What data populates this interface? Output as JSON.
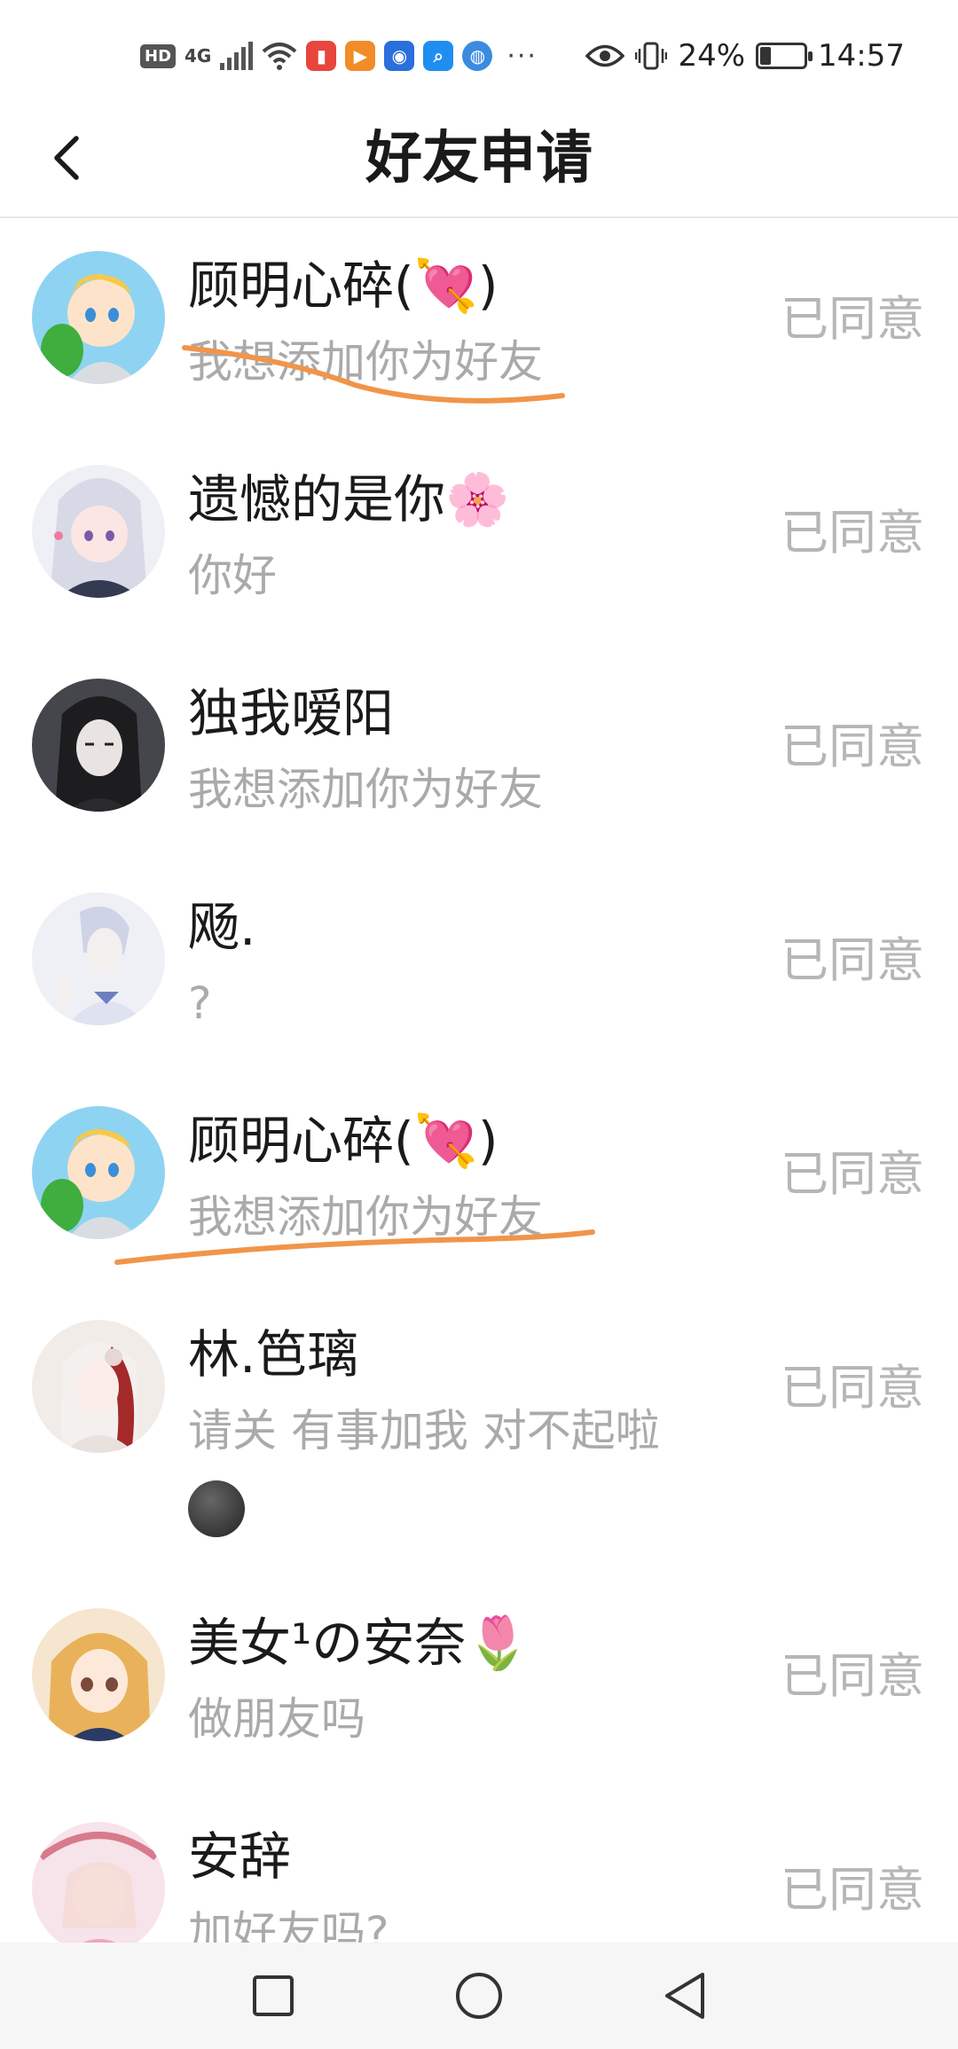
{
  "status_bar": {
    "hd": "HD",
    "network": "4G",
    "more": "···",
    "battery": "24%",
    "time": "14:57",
    "battery_level": 0.24
  },
  "header": {
    "title": "好友申请"
  },
  "requests": [
    {
      "name": "顾明心碎(💘)",
      "message": "我想添加你为好友",
      "status": "已同意"
    },
    {
      "name": "遗憾的是你🌸",
      "message": "你好",
      "status": "已同意"
    },
    {
      "name": "独我嗳阳",
      "message": "我想添加你为好友",
      "status": "已同意"
    },
    {
      "name": "飏.",
      "message": "?",
      "status": "已同意"
    },
    {
      "name": "顾明心碎(💘)",
      "message": "我想添加你为好友",
      "status": "已同意"
    },
    {
      "name": "林.笆璃",
      "message": "请关 有事加我 对不起啦",
      "status": "已同意"
    },
    {
      "name": "美女¹の安奈🌷",
      "message": "做朋友吗",
      "status": "已同意"
    },
    {
      "name": "安辞",
      "message": "加好友吗?",
      "status": "已同意"
    }
  ],
  "colors": {
    "annotation_stroke": "#f0954a",
    "status_text": "#b6b6b6",
    "message_text": "#aaaaaa"
  }
}
